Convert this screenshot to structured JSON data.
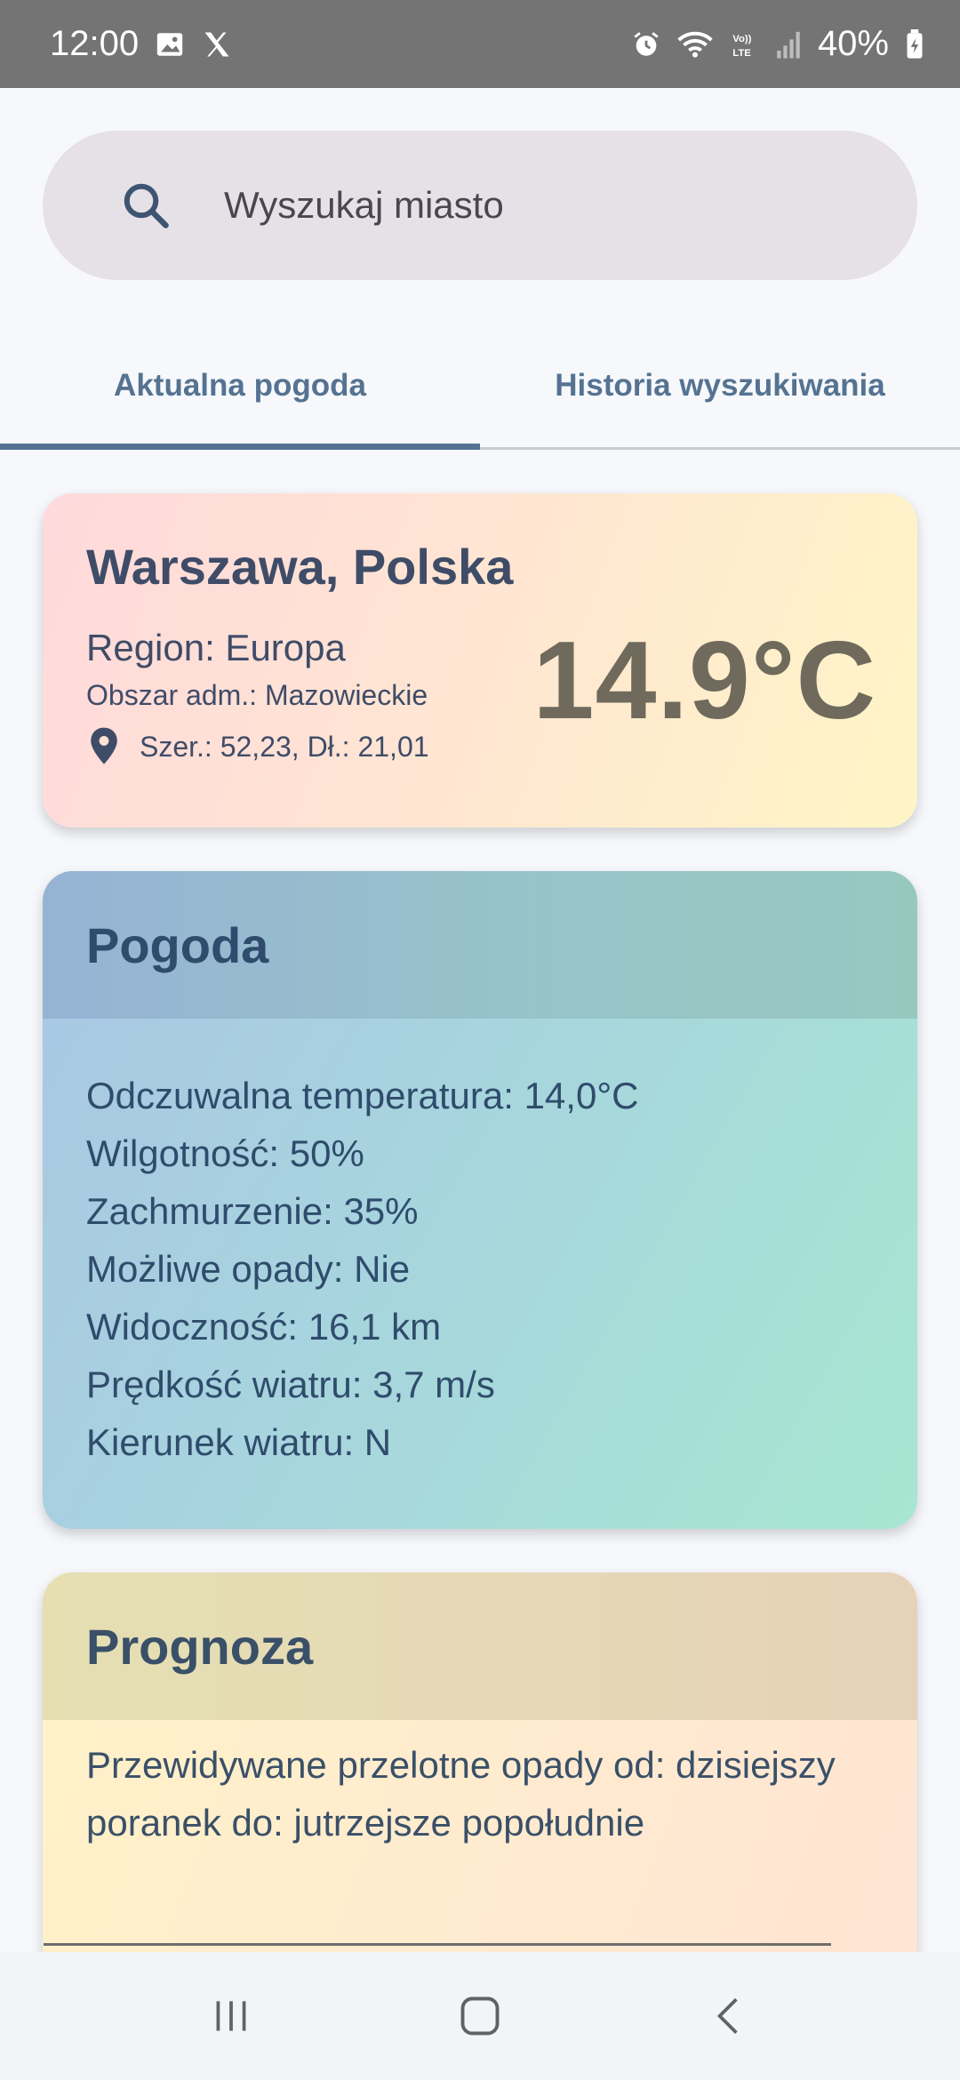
{
  "status_bar": {
    "time": "12:00",
    "battery": "40%",
    "icons": [
      "image-icon",
      "x-logo-icon",
      "alarm-icon",
      "wifi-icon",
      "volte-icon",
      "signal-icon",
      "battery-icon"
    ]
  },
  "search": {
    "placeholder": "Wyszukaj miasto",
    "value": ""
  },
  "tabs": [
    {
      "label": "Aktualna pogoda",
      "active": true
    },
    {
      "label": "Historia wyszukiwania",
      "active": false
    }
  ],
  "location_card": {
    "title": "Warszawa, Polska",
    "region": "Region: Europa",
    "admin_area": "Obszar adm.: Mazowieckie",
    "coordinates": "Szer.: 52,23, Dł.: 21,01",
    "temperature": "14.9°C"
  },
  "weather_card": {
    "title": "Pogoda",
    "items": [
      "Odczuwalna temperatura: 14,0°C",
      "Wilgotność: 50%",
      "Zachmurzenie: 35%",
      "Możliwe opady: Nie",
      "Widoczność: 16,1 km",
      "Prędkość wiatru: 3,7 m/s",
      "Kierunek wiatru: N"
    ]
  },
  "forecast_card": {
    "title": "Prognoza",
    "text": "Przewidywane przelotne opady od: dzisiejszy poranek do: jutrzejsze popołudnie"
  },
  "colors": {
    "accent": "#557391",
    "status_bar": "#747474",
    "temperature": "#6f6a5c"
  }
}
